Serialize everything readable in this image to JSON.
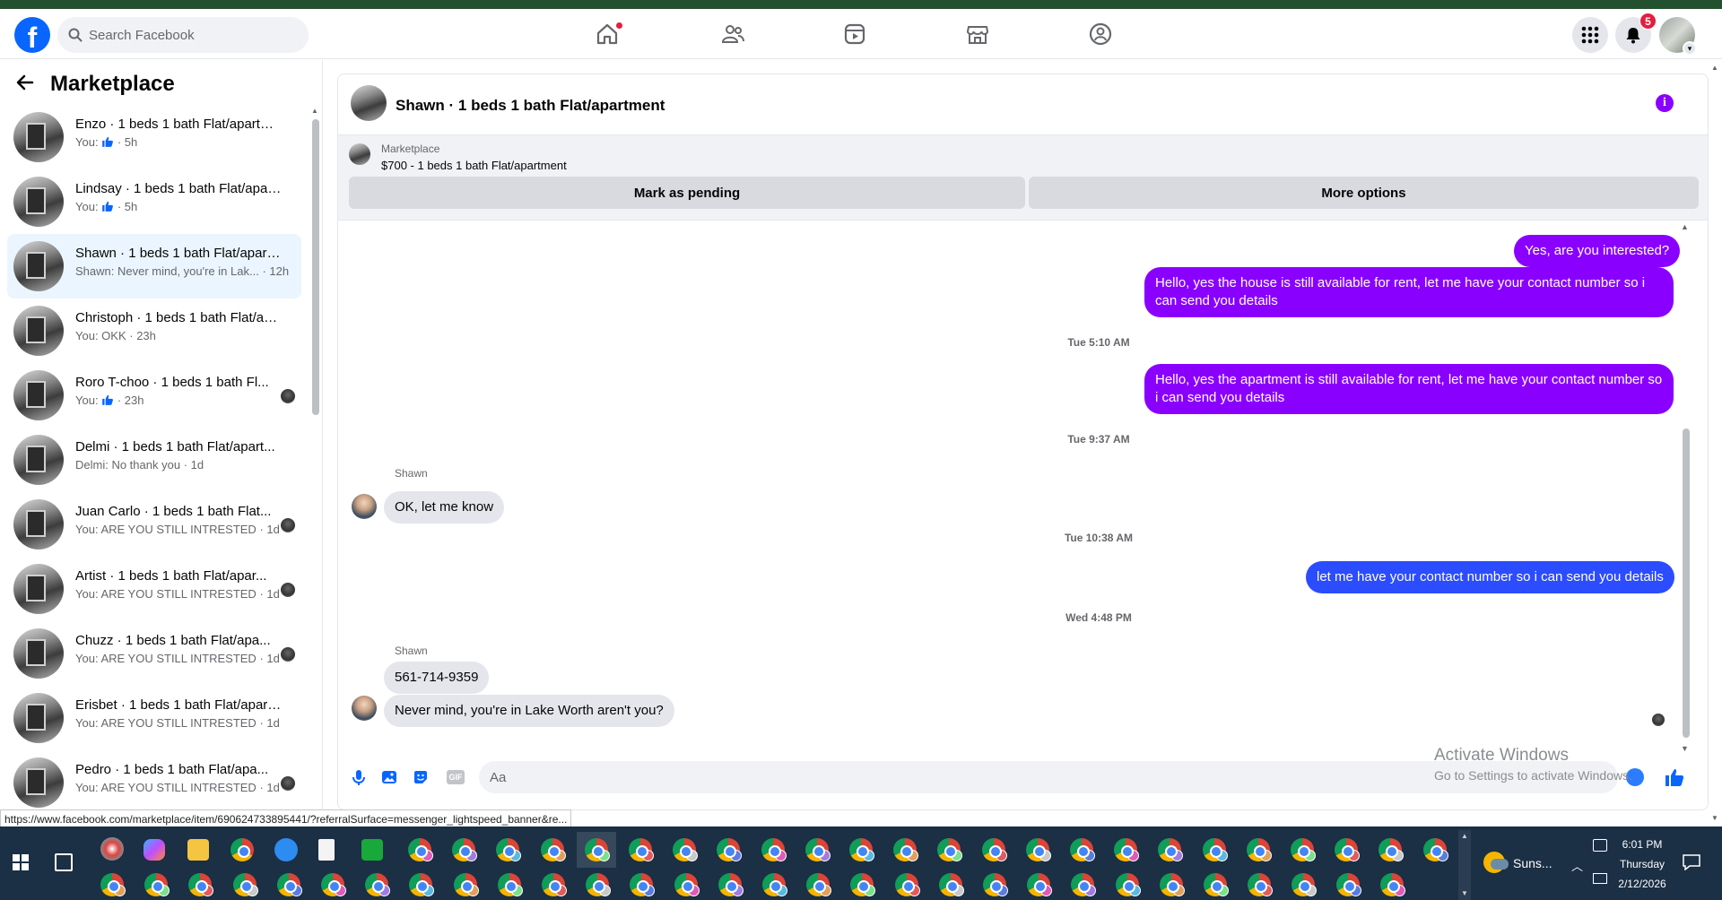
{
  "topnav": {
    "search_placeholder": "Search Facebook",
    "notification_count": "5",
    "logo_letter": "f"
  },
  "marketplace": {
    "title": "Marketplace",
    "conversations": [
      {
        "name": "Enzo · 1 beds 1 bath Flat/apartm...",
        "snippet_prefix": "You:",
        "snippet": "",
        "time": "· 5h",
        "like": true,
        "active": false
      },
      {
        "name": "Lindsay · 1 beds 1 bath Flat/apar...",
        "snippet_prefix": "You:",
        "snippet": "",
        "time": "· 5h",
        "like": true,
        "active": false
      },
      {
        "name": "Shawn · 1 beds 1 bath Flat/apart...",
        "snippet_prefix": "",
        "snippet": "Shawn: Never mind, you're in Lak...",
        "time": "· 12h",
        "like": false,
        "active": true
      },
      {
        "name": "Christoph · 1 beds 1 bath Flat/ap...",
        "snippet_prefix": "",
        "snippet": "You: OKK",
        "time": "· 23h",
        "like": false,
        "active": false
      },
      {
        "name": "Roro T-choo · 1 beds 1 bath Fl...",
        "snippet_prefix": "You:",
        "snippet": "",
        "time": "· 23h",
        "like": true,
        "active": false,
        "mini": true
      },
      {
        "name": "Delmi · 1 beds 1 bath Flat/apart...",
        "snippet_prefix": "",
        "snippet": "Delmi: No thank you",
        "time": "· 1d",
        "like": false,
        "active": false
      },
      {
        "name": "Juan Carlo · 1 beds 1 bath Flat...",
        "snippet_prefix": "",
        "snippet": "You: ARE YOU STILL INTRESTED",
        "time": "· 1d",
        "like": false,
        "active": false,
        "mini": true
      },
      {
        "name": "Artist · 1 beds 1 bath Flat/apar...",
        "snippet_prefix": "",
        "snippet": "You: ARE YOU STILL INTRESTED",
        "time": "· 1d",
        "like": false,
        "active": false,
        "mini": true
      },
      {
        "name": "Chuzz · 1 beds 1 bath Flat/apa...",
        "snippet_prefix": "",
        "snippet": "You: ARE YOU STILL INTRESTED",
        "time": "· 1d",
        "like": false,
        "active": false,
        "mini": true
      },
      {
        "name": "Erisbet · 1 beds 1 bath Flat/apart...",
        "snippet_prefix": "",
        "snippet": "You: ARE YOU STILL INTRESTED",
        "time": "· 1d",
        "like": false,
        "active": false
      },
      {
        "name": "Pedro · 1 beds 1 bath Flat/apa...",
        "snippet_prefix": "",
        "snippet": "You: ARE YOU STILL INTRESTED",
        "time": "· 1d",
        "like": false,
        "active": false,
        "mini": true
      }
    ]
  },
  "chat": {
    "title": "Shawn · 1 beds 1 bath Flat/apartment",
    "listing_source": "Marketplace",
    "listing_price": "$700 - 1 beds 1 bath Flat/apartment",
    "mark_pending_label": "Mark as pending",
    "more_options_label": "More options",
    "messages": {
      "out1": "Yes, are you interested?",
      "out2": "Hello, yes the house is still available for rent, let me have your contact number so i can send you details",
      "ts1": "Tue 5:10 AM",
      "out3": "Hello, yes the apartment is still available for rent, let me have your contact number so i can send you details",
      "ts2": "Tue 9:37 AM",
      "sender1": "Shawn",
      "in1": "OK, let me know",
      "ts3": "Tue 10:38 AM",
      "out4": "let me have your contact number so i can send you details",
      "ts4": "Wed 4:48 PM",
      "sender2": "Shawn",
      "in2": "561-714-9359",
      "in3": "Never mind, you're in Lake Worth aren't you?"
    },
    "composer_placeholder": "Aa"
  },
  "watermark": {
    "line1": "Activate Windows",
    "line2": "Go to Settings to activate Windows."
  },
  "status_url": "https://www.facebook.com/marketplace/item/690624733895441/?referralSurface=messenger_lightspeed_banner&re...",
  "taskbar": {
    "weather": "Suns...",
    "time": "6:01 PM",
    "day": "Thursday",
    "date": "2/12/2026"
  },
  "colors": {
    "accent_purple": "#8a00ff",
    "accent_blue": "#2b4cff",
    "facebook_blue": "#0866ff"
  }
}
